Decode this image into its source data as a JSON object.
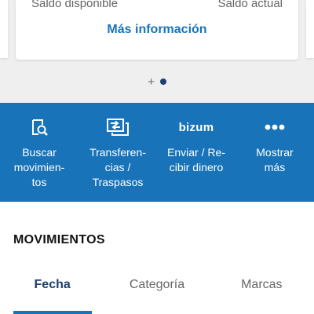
{
  "account_card": {
    "available_label": "Saldo disponible",
    "current_label": "Saldo actual",
    "more_info_link": "Más información"
  },
  "pager": {
    "add_symbol": "+",
    "current_page": 1
  },
  "quick_actions": [
    {
      "id": "search",
      "icon": "search-document-icon",
      "label": "Buscar\nmovimien-\ntos"
    },
    {
      "id": "transfers",
      "icon": "transfer-icon",
      "label": "Transferen-\ncias /\nTraspasos"
    },
    {
      "id": "bizum",
      "icon": "bizum-logo",
      "logo_text": "bizum",
      "label": "Enviar / Re-\ncibir dinero"
    },
    {
      "id": "more",
      "icon": "more-dots-icon",
      "label": "Mostrar\nmás"
    }
  ],
  "movements": {
    "title": "MOVIMIENTOS",
    "tabs": [
      {
        "label": "Fecha",
        "active": true
      },
      {
        "label": "Categoría",
        "active": false
      },
      {
        "label": "Marcas",
        "active": false
      }
    ]
  },
  "colors": {
    "brand_blue": "#1973b8",
    "navy": "#1d3f6e",
    "background": "#f4f4f4"
  }
}
